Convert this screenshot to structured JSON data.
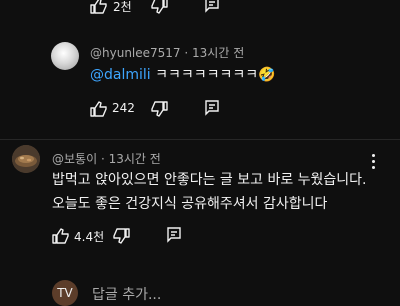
{
  "top_actions": {
    "like_count": "2천"
  },
  "reply": {
    "author": "@hyunlee7517",
    "time": "13시간 전",
    "mention": "@dalmili",
    "text": "ㅋㅋㅋㅋㅋㅋㅋㅋ",
    "emoji": "🤣",
    "like_count": "242"
  },
  "comment": {
    "author": "@보통이",
    "time": "13시간 전",
    "text_line1": "밥먹고 앉아있으면 안좋다는 글 보고 바로 누웠습니다.",
    "text_line2": "오늘도 좋은 건강지식 공유해주셔서 감사합니다",
    "like_count": "4.4천"
  },
  "composer": {
    "avatar_initials": "TV",
    "placeholder": "답글 추가..."
  },
  "colors": {
    "background": "#0f0f0f",
    "meta": "#aaaaaa",
    "mention": "#3ea6ff"
  }
}
